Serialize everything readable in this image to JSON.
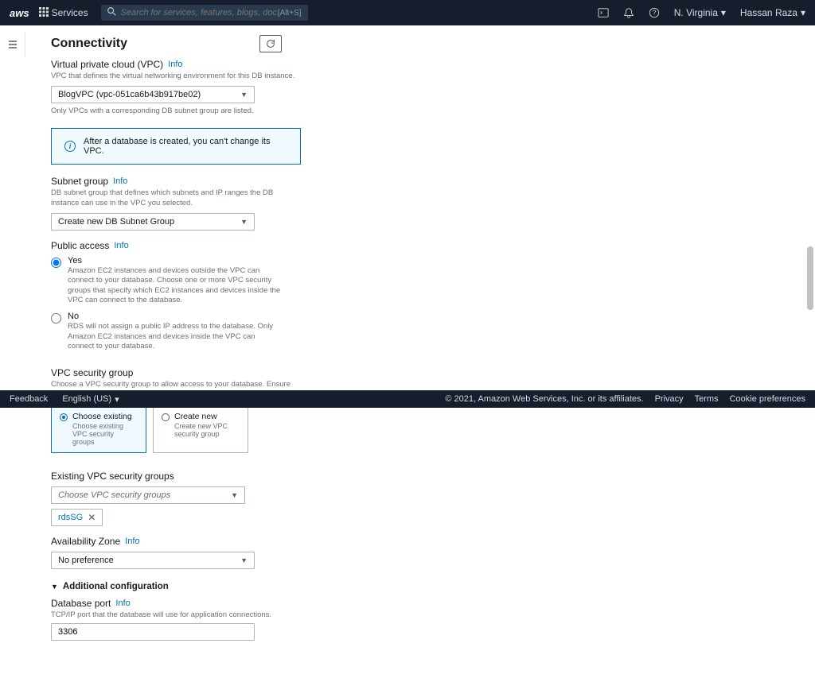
{
  "nav": {
    "logo": "aws",
    "services": "Services",
    "search_placeholder": "Search for services, features, blogs, docs, and more",
    "search_shortcut": "[Alt+S]",
    "region": "N. Virginia",
    "user": "Hassan Raza"
  },
  "panel": {
    "title": "Connectivity"
  },
  "vpc": {
    "label": "Virtual private cloud (VPC)",
    "info": "Info",
    "desc": "VPC that defines the virtual networking environment for this DB instance.",
    "value": "BlogVPC (vpc-051ca6b43b917be02)",
    "help": "Only VPCs with a corresponding DB subnet group are listed."
  },
  "info_box": {
    "text": "After a database is created, you can't change its VPC."
  },
  "subnet": {
    "label": "Subnet group",
    "info": "Info",
    "desc": "DB subnet group that defines which subnets and IP ranges the DB instance can use in the VPC you selected.",
    "value": "Create new DB Subnet Group"
  },
  "public_access": {
    "label": "Public access",
    "info": "Info",
    "yes_label": "Yes",
    "yes_desc": "Amazon EC2 instances and devices outside the VPC can connect to your database. Choose one or more VPC security groups that specify which EC2 instances and devices inside the VPC can connect to the database.",
    "no_label": "No",
    "no_desc": "RDS will not assign a public IP address to the database. Only Amazon EC2 instances and devices inside the VPC can connect to your database."
  },
  "security_group": {
    "label": "VPC security group",
    "desc": "Choose a VPC security group to allow access to your database. Ensure that the security group rules allow the appropriate incoming traffic.",
    "existing_label": "Choose existing",
    "existing_desc": "Choose existing VPC security groups",
    "create_label": "Create new",
    "create_desc": "Create new VPC security group"
  },
  "existing_sg": {
    "label": "Existing VPC security groups",
    "placeholder": "Choose VPC security groups",
    "tag": "rdsSG"
  },
  "az": {
    "label": "Availability Zone",
    "info": "Info",
    "value": "No preference"
  },
  "additional": {
    "label": "Additional configuration"
  },
  "port": {
    "label": "Database port",
    "info": "Info",
    "desc": "TCP/IP port that the database will use for application connections.",
    "value": "3306"
  },
  "footer": {
    "feedback": "Feedback",
    "language": "English (US)",
    "copyright": "© 2021, Amazon Web Services, Inc. or its affiliates.",
    "privacy": "Privacy",
    "terms": "Terms",
    "cookies": "Cookie preferences"
  }
}
